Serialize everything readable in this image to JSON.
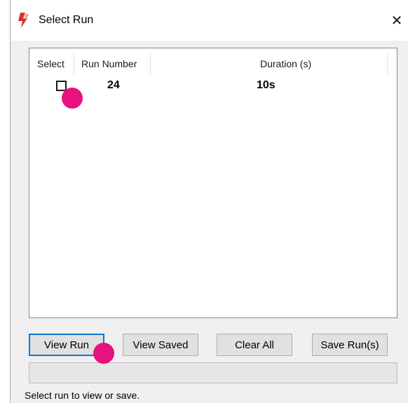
{
  "window": {
    "title": "Select Run",
    "app_icon": "app-logo-icon",
    "close_icon": "close-icon",
    "close_glyph": "✕"
  },
  "listview": {
    "columns": [
      "Select",
      "Run Number",
      "Duration (s)"
    ],
    "rows": [
      {
        "selected": false,
        "run_number": "24",
        "duration": "10s"
      }
    ]
  },
  "buttons": {
    "view_run": "View Run",
    "view_saved": "View Saved",
    "clear_all": "Clear All",
    "save_runs": "Save Run(s)"
  },
  "progress": {
    "value": 0
  },
  "status": "Select run to view or save.",
  "colors": {
    "accent": "#0078d7",
    "marker": "#e6127f",
    "icon_red": "#d9322b"
  }
}
